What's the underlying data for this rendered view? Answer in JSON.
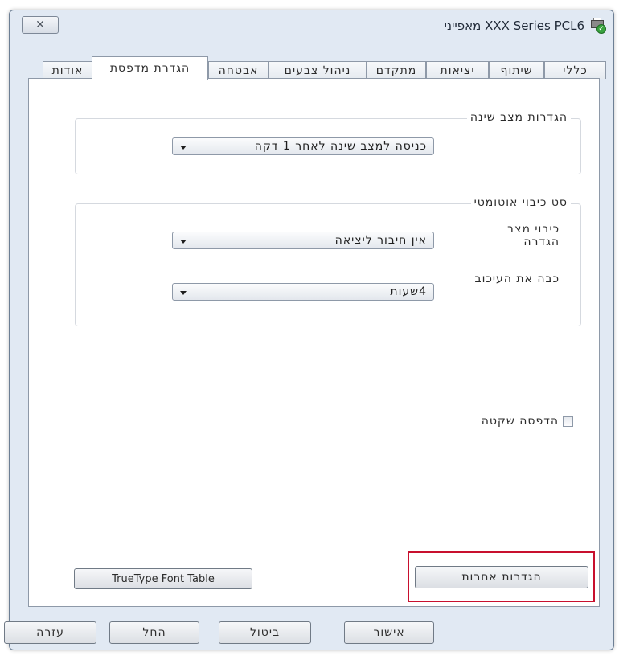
{
  "window": {
    "title": "XXX Series PCL6 מאפייני",
    "close_symbol": "✕",
    "icon": "printer-check-icon"
  },
  "tabs": [
    {
      "label": "כללי"
    },
    {
      "label": "שיתוף"
    },
    {
      "label": "יציאות"
    },
    {
      "label": "מתקדם"
    },
    {
      "label": "ניהול צבעים"
    },
    {
      "label": "אבטחה"
    },
    {
      "label": "הגדרת מדפסת",
      "active": true
    },
    {
      "label": "אודות"
    }
  ],
  "sleep_group": {
    "legend": "הגדרות מצב שינה",
    "value": "כניסה למצב שינה לאחר 1 דקה"
  },
  "auto_off_group": {
    "legend": "סט כיבוי אוטומטי",
    "mode_label_line1": "כיבוי מצב",
    "mode_label_line2": "הגדרה",
    "mode_value": "אין חיבור ליציאה",
    "delay_label": "כבה את העיכוב",
    "delay_value": "4שעות"
  },
  "quiet_print": {
    "label": "הדפסה שקטה",
    "checked": false
  },
  "buttons": {
    "truetype": "TrueType Font Table",
    "other_settings": "הגדרות אחרות",
    "ok": "אישור",
    "cancel": "ביטול",
    "apply": "החל",
    "help": "עזרה"
  },
  "colors": {
    "highlight": "#c8102e",
    "window_bg": "#e1e9f3"
  }
}
